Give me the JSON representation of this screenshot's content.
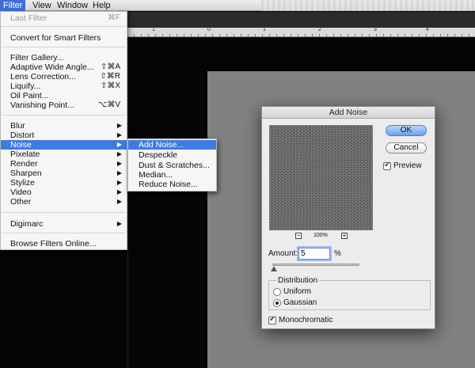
{
  "menubar": {
    "items": [
      {
        "label": "Filter",
        "active": true
      },
      {
        "label": "View",
        "active": false
      },
      {
        "label": "Window",
        "active": false
      },
      {
        "label": "Help",
        "active": false
      }
    ]
  },
  "ruler": {
    "ticks": [
      "1",
      "0",
      "1",
      "2",
      "3",
      "4"
    ]
  },
  "filter_menu": {
    "last_filter": {
      "label": "Last Filter",
      "shortcut": "⌘F"
    },
    "convert": "Convert for Smart Filters",
    "gallery": "Filter Gallery...",
    "adaptive": {
      "label": "Adaptive Wide Angle...",
      "shortcut": "⇧⌘A"
    },
    "lens": {
      "label": "Lens Correction...",
      "shortcut": "⇧⌘R"
    },
    "liquify": {
      "label": "Liquify...",
      "shortcut": "⇧⌘X"
    },
    "oilpaint": "Oil Paint...",
    "vanishing": {
      "label": "Vanishing Point...",
      "shortcut": "⌥⌘V"
    },
    "blur": "Blur",
    "distort": "Distort",
    "noise": "Noise",
    "pixelate": "Pixelate",
    "render": "Render",
    "sharpen": "Sharpen",
    "stylize": "Stylize",
    "video": "Video",
    "other": "Other",
    "digimarc": "Digimarc",
    "browse": "Browse Filters Online...",
    "submenu_arrow": "▶"
  },
  "noise_submenu": {
    "add_noise": "Add Noise...",
    "despeckle": "Despeckle",
    "dust": "Dust & Scratches...",
    "median": "Median...",
    "reduce": "Reduce Noise..."
  },
  "dialog": {
    "title": "Add Noise",
    "ok": "OK",
    "cancel": "Cancel",
    "preview_label": "Preview",
    "preview_checked": true,
    "zoom": "100%",
    "zoom_out": "−",
    "zoom_in": "+",
    "amount_label": "Amount:",
    "amount_value": "5",
    "amount_unit": "%",
    "distribution_label": "Distribution",
    "uniform": "Uniform",
    "gaussian": "Gaussian",
    "selected_distribution": "Gaussian",
    "monochromatic": "Monochromatic",
    "monochromatic_checked": true
  },
  "colors": {
    "menu_highlight": "#3e7be0",
    "document_gray": "#818181",
    "canvas_bg": "#050505"
  }
}
